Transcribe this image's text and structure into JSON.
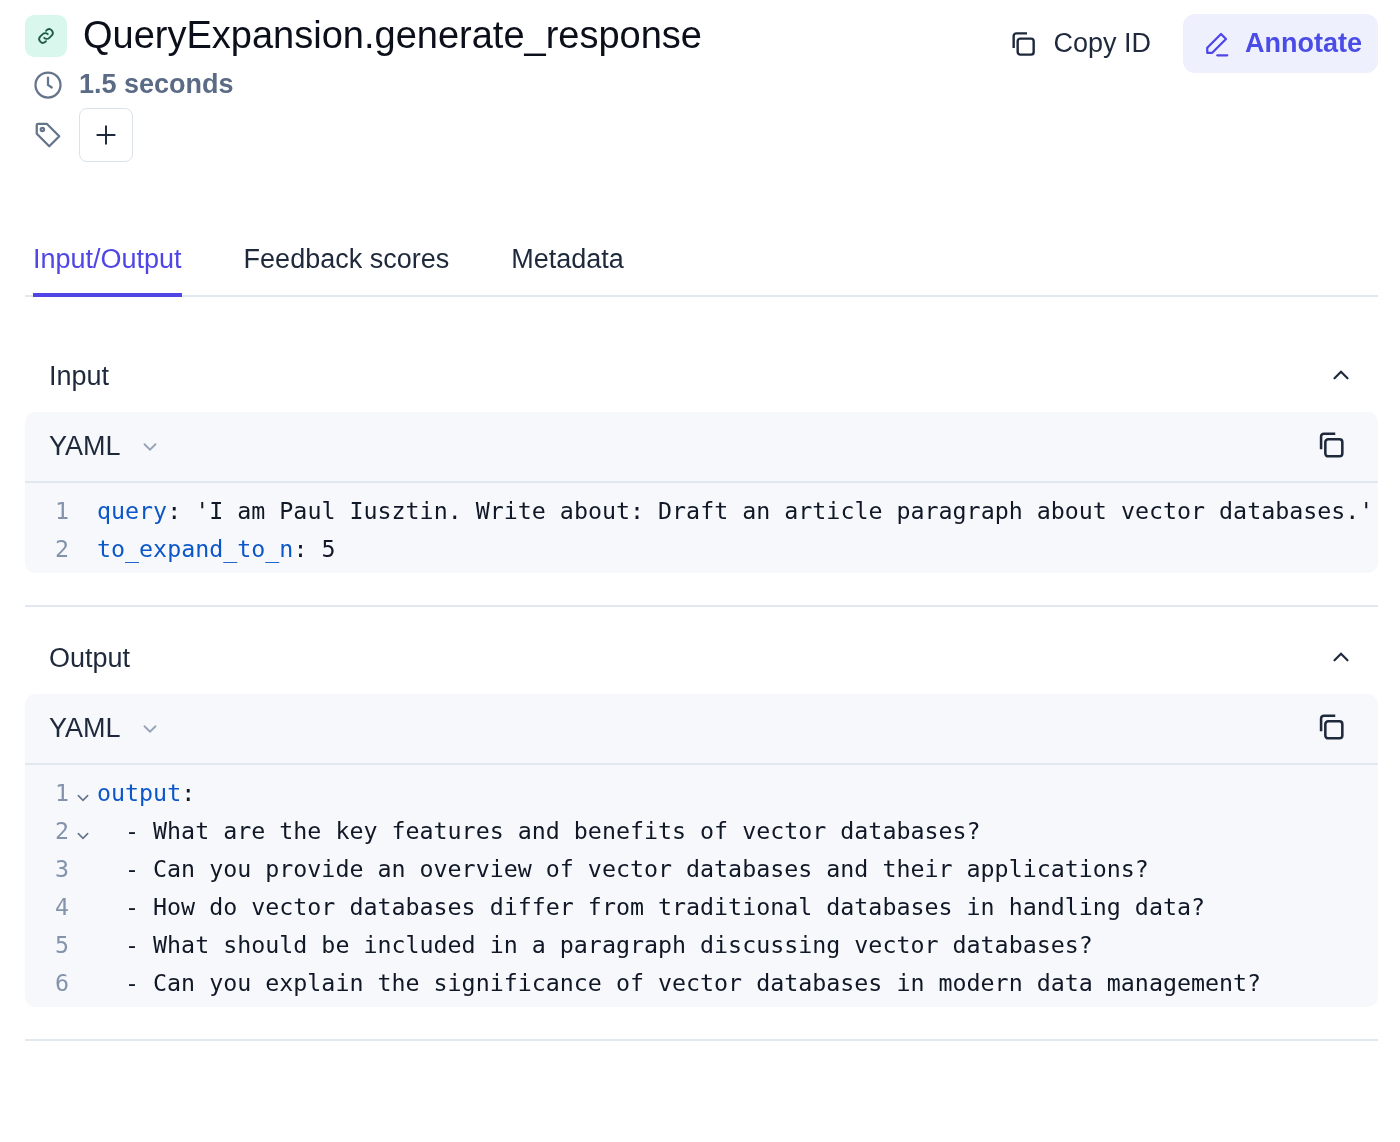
{
  "header": {
    "title": "QueryExpansion.generate_response",
    "duration": "1.5 seconds",
    "copy_button": "Copy ID",
    "annotate_button": "Annotate"
  },
  "tabs": [
    {
      "label": "Input/Output",
      "selected": true
    },
    {
      "label": "Feedback scores",
      "selected": false
    },
    {
      "label": "Metadata",
      "selected": false
    }
  ],
  "sections": [
    {
      "title": "Input",
      "expanded": true,
      "format": "YAML",
      "lines": [
        {
          "number": "1",
          "segments": [
            {
              "kind": "key",
              "text": "query"
            },
            {
              "kind": "plain",
              "text": ": 'I am Paul Iusztin. Write about: Draft an article paragraph about vector databases.'"
            }
          ]
        },
        {
          "number": "2",
          "segments": [
            {
              "kind": "key",
              "text": "to_expand_to_n"
            },
            {
              "kind": "plain",
              "text": ": 5"
            }
          ]
        }
      ]
    },
    {
      "title": "Output",
      "expanded": true,
      "format": "YAML",
      "lines": [
        {
          "number": "1",
          "expanded": true,
          "segments": [
            {
              "kind": "key",
              "text": "output"
            },
            {
              "kind": "plain",
              "text": ":"
            }
          ]
        },
        {
          "number": "2",
          "expanded": true,
          "segments": [
            {
              "kind": "item",
              "text": "- What are the key features and benefits of vector databases?"
            }
          ]
        },
        {
          "number": "3",
          "segments": [
            {
              "kind": "item",
              "text": "- Can you provide an overview of vector databases and their applications?"
            }
          ]
        },
        {
          "number": "4",
          "segments": [
            {
              "kind": "item",
              "text": "- How do vector databases differ from traditional databases in handling data?"
            }
          ]
        },
        {
          "number": "5",
          "segments": [
            {
              "kind": "item",
              "text": "- What should be included in a paragraph discussing vector databases?"
            }
          ]
        },
        {
          "number": "6",
          "segments": [
            {
              "kind": "item",
              "text": "- Can you explain the significance of vector databases in modern data management?"
            }
          ]
        }
      ]
    }
  ]
}
